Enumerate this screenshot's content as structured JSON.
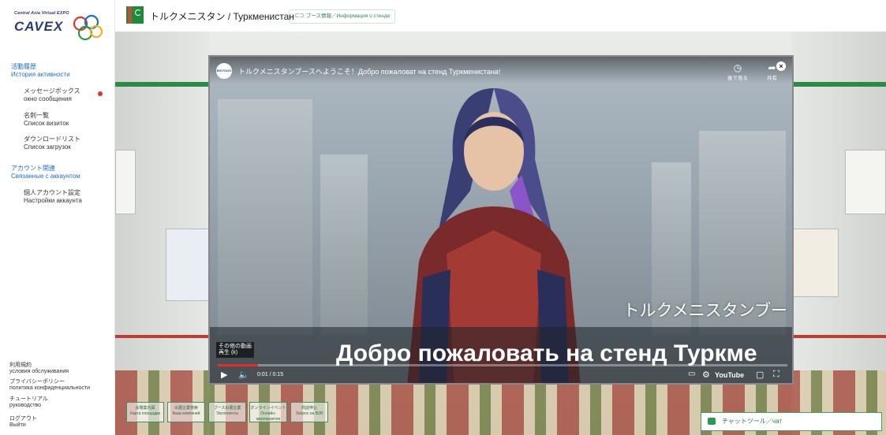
{
  "logo": {
    "tagline": "Central Asia Virtual EXPO",
    "wordmark": "CAVEX"
  },
  "sidebar": {
    "activity_heading_ja": "活動履歴",
    "activity_heading_ru": "История активности",
    "items": [
      {
        "ja": "メッセージボックス",
        "ru": "окно сообщения"
      },
      {
        "ja": "名刺一覧",
        "ru": "Список визиток"
      },
      {
        "ja": "ダウンロードリスト",
        "ru": "Список загрузок"
      }
    ],
    "account_heading_ja": "アカウント関連",
    "account_heading_ru": "Связанные с аккаунтом",
    "account_item": {
      "ja": "個人アカウント設定",
      "ru": "Настройки аккаунта"
    },
    "footer": [
      {
        "ja": "利用規約",
        "ru": "условия обслуживания"
      },
      {
        "ja": "プライバシーポリシー",
        "ru": "политика конфиденциальности"
      },
      {
        "ja": "チュートリアル",
        "ru": "руководство"
      },
      {
        "ja": "ログアウト",
        "ru": "Выйти"
      }
    ]
  },
  "header": {
    "title": "トルクメニスタン / Туркменистан",
    "booth_info": "ブース情報／Информация о стенде"
  },
  "video": {
    "channel_icon_text": "BIOTODO",
    "title": "トルクメニスタンブースへようこそ！Добро пожаловат на стенд Туркменистана!",
    "watch_later": "後で見る",
    "share": "共有",
    "caption_jp": "トルクメニスタンブー",
    "caption_ru": "Добро пожаловать на стенд Туркме",
    "related_line1": "その他の動画",
    "related_line2": "再生 (k)",
    "time": "0:01 / 0:15",
    "progress_fraction": 0.07,
    "youtube_label": "YouTube"
  },
  "bottom_buttons": [
    {
      "ja": "会場案内図",
      "ru": "Карта площадки"
    },
    {
      "ja": "出展企業検索",
      "ru": "База компаний"
    },
    {
      "ja": "ブース出展企業",
      "ru": "Экспоненты"
    },
    {
      "ja": "オンラインイベント",
      "ru": "Онлайн-мероприятия"
    },
    {
      "ja": "商談申込",
      "ru": "Запрос на B2B"
    }
  ],
  "chat": {
    "label": "チャットツール／чат"
  },
  "colors": {
    "accent_blue": "#1d6fc7",
    "accent_green": "#2b8a55",
    "badge_red": "#e0342b",
    "youtube_red": "#e52d27"
  }
}
